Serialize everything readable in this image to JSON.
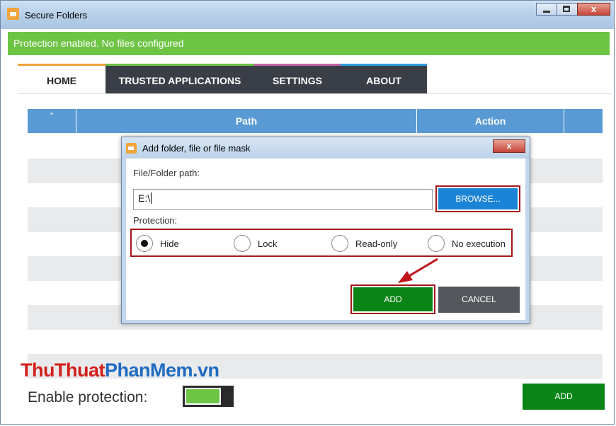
{
  "window": {
    "title": "Secure Folders"
  },
  "status": {
    "text": "Protection enabled. No files configured"
  },
  "tabs": [
    {
      "label": "HOME"
    },
    {
      "label": "TRUSTED APPLICATIONS"
    },
    {
      "label": "SETTINGS"
    },
    {
      "label": "ABOUT"
    }
  ],
  "table": {
    "columns": [
      "",
      "Path",
      "Action"
    ]
  },
  "watermark": {
    "part1": "ThuThuat",
    "part2": "PhanMem.vn"
  },
  "footer": {
    "enable_label": "Enable protection:",
    "add_label": "ADD",
    "protection_on": true
  },
  "dialog": {
    "title": "Add folder, file or file mask",
    "path_label": "File/Folder path:",
    "path_value": "E:\\",
    "browse_label": "BROWSE...",
    "protection_label": "Protection:",
    "options": [
      {
        "label": "Hide",
        "selected": true
      },
      {
        "label": "Lock",
        "selected": false
      },
      {
        "label": "Read-only",
        "selected": false
      },
      {
        "label": "No execution",
        "selected": false
      }
    ],
    "add_label": "ADD",
    "cancel_label": "CANCEL"
  },
  "colors": {
    "status_green": "#6ec445",
    "header_blue": "#5a9ad4",
    "action_green": "#0a8416",
    "browse_blue": "#1b84d6",
    "highlight_red": "#a3151b"
  }
}
